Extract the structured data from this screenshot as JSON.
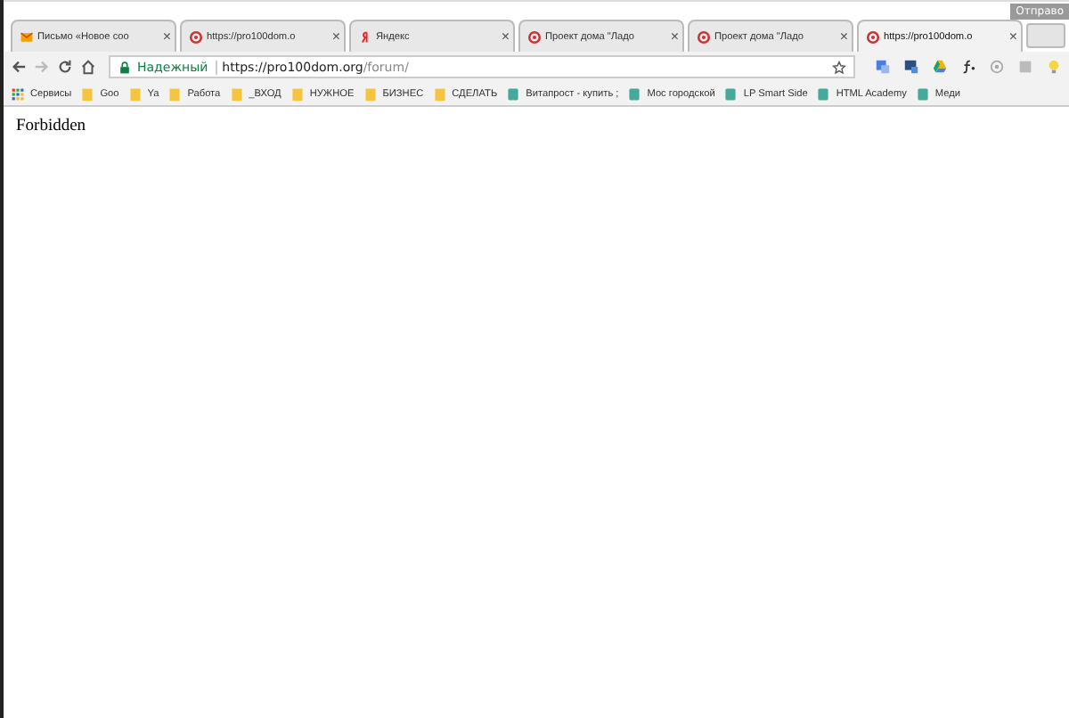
{
  "profile_badge": "Отправо",
  "tabs": [
    {
      "title": "Письмо «Новое соо",
      "kind": "mail",
      "selected": false
    },
    {
      "title": "https://pro100dom.o",
      "kind": "site",
      "selected": false
    },
    {
      "title": "Яндекс",
      "kind": "yandex",
      "selected": false
    },
    {
      "title": "Проект дома \"Ладо",
      "kind": "site",
      "selected": false
    },
    {
      "title": "Проект дома \"Ладо",
      "kind": "site",
      "selected": false
    },
    {
      "title": "https://pro100dom.o",
      "kind": "site",
      "selected": true
    }
  ],
  "tab_close": "×",
  "address": {
    "security": "Надежный",
    "origin": "https://pro100dom.org",
    "path": "/forum/"
  },
  "bookmarks": [
    {
      "label": "Сервисы",
      "kind": "apps"
    },
    {
      "label": "Goo",
      "kind": "folder"
    },
    {
      "label": "Ya",
      "kind": "folder"
    },
    {
      "label": "Работа",
      "kind": "folder"
    },
    {
      "label": "_ВХОД",
      "kind": "folder"
    },
    {
      "label": "НУЖНОЕ",
      "kind": "folder"
    },
    {
      "label": "БИЗНЕС",
      "kind": "folder"
    },
    {
      "label": "СДЕЛАТЬ",
      "kind": "folder"
    },
    {
      "label": "Витапрост - купить ;",
      "kind": "site"
    },
    {
      "label": "Мос городской",
      "kind": "site"
    },
    {
      "label": "LP Smart Side",
      "kind": "site"
    },
    {
      "label": "HTML Academy",
      "kind": "site"
    },
    {
      "label": "Меди",
      "kind": "site"
    }
  ],
  "page": {
    "text": "Forbidden"
  }
}
